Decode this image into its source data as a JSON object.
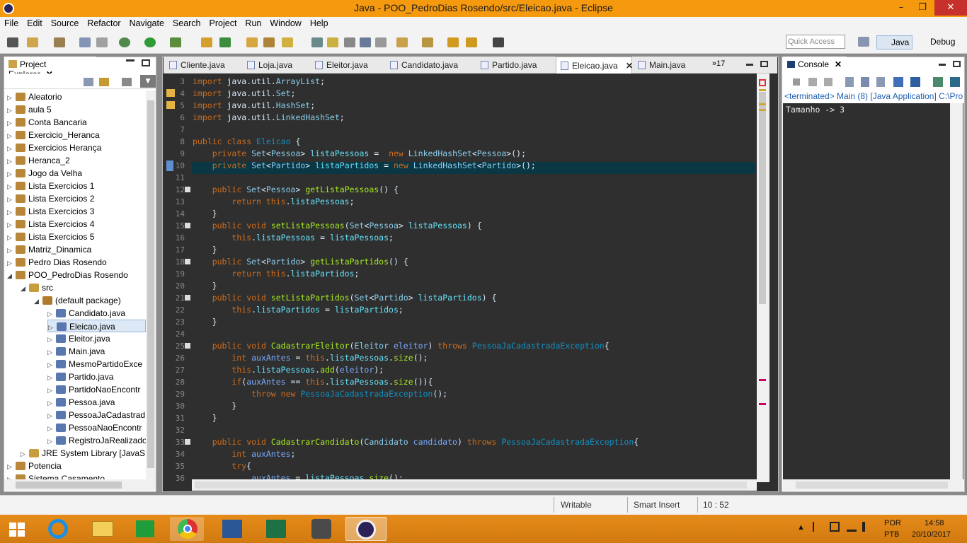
{
  "window": {
    "title": "Java - POO_PedroDias Rosendo/src/Eleicao.java - Eclipse",
    "min": "–",
    "max": "❐",
    "close": "✕"
  },
  "menu": [
    "File",
    "Edit",
    "Source",
    "Refactor",
    "Navigate",
    "Search",
    "Project",
    "Run",
    "Window",
    "Help"
  ],
  "quick_access": {
    "placeholder": "Quick Access"
  },
  "perspectives": {
    "java": "Java",
    "debug": "Debug"
  },
  "project_explorer": {
    "title": "Project Explorer",
    "items": [
      {
        "label": "Aleatorio",
        "depth": 0,
        "exp": "▷"
      },
      {
        "label": "aula 5",
        "depth": 0,
        "exp": "▷"
      },
      {
        "label": "Conta Bancaria",
        "depth": 0,
        "exp": "▷"
      },
      {
        "label": "Exercicio_Heranca",
        "depth": 0,
        "exp": "▷"
      },
      {
        "label": "Exercicios Herança",
        "depth": 0,
        "exp": "▷"
      },
      {
        "label": "Heranca_2",
        "depth": 0,
        "exp": "▷"
      },
      {
        "label": "Jogo da Velha",
        "depth": 0,
        "exp": "▷"
      },
      {
        "label": "Lista Exercicios 1",
        "depth": 0,
        "exp": "▷"
      },
      {
        "label": "Lista Exercicios 2",
        "depth": 0,
        "exp": "▷"
      },
      {
        "label": "Lista Exercicios 3",
        "depth": 0,
        "exp": "▷"
      },
      {
        "label": "Lista Exercicios 4",
        "depth": 0,
        "exp": "▷"
      },
      {
        "label": "Lista Exercicios 5",
        "depth": 0,
        "exp": "▷"
      },
      {
        "label": "Matriz_Dinamica",
        "depth": 0,
        "exp": "▷"
      },
      {
        "label": "Pedro Dias Rosendo",
        "depth": 0,
        "exp": "▷"
      },
      {
        "label": "POO_PedroDias Rosendo",
        "depth": 0,
        "exp": "◢"
      },
      {
        "label": "src",
        "depth": 1,
        "exp": "◢"
      },
      {
        "label": "(default package)",
        "depth": 2,
        "exp": "◢"
      },
      {
        "label": "Candidato.java",
        "depth": 3,
        "exp": "▷"
      },
      {
        "label": "Eleicao.java",
        "depth": 3,
        "exp": "▷",
        "selected": true
      },
      {
        "label": "Eleitor.java",
        "depth": 3,
        "exp": "▷"
      },
      {
        "label": "Main.java",
        "depth": 3,
        "exp": "▷"
      },
      {
        "label": "MesmoPartidoExce",
        "depth": 3,
        "exp": "▷"
      },
      {
        "label": "Partido.java",
        "depth": 3,
        "exp": "▷"
      },
      {
        "label": "PartidoNaoEncontr",
        "depth": 3,
        "exp": "▷"
      },
      {
        "label": "Pessoa.java",
        "depth": 3,
        "exp": "▷"
      },
      {
        "label": "PessoaJaCadastrad",
        "depth": 3,
        "exp": "▷"
      },
      {
        "label": "PessoaNaoEncontr",
        "depth": 3,
        "exp": "▷"
      },
      {
        "label": "RegistroJaRealizado",
        "depth": 3,
        "exp": "▷"
      },
      {
        "label": "JRE System Library [JavaSE",
        "depth": 1,
        "exp": "▷"
      },
      {
        "label": "Potencia",
        "depth": 0,
        "exp": "▷"
      },
      {
        "label": "Sistema Casamento",
        "depth": 0,
        "exp": "▷"
      }
    ]
  },
  "editor_tabs": [
    {
      "label": "Cliente.java"
    },
    {
      "label": "Loja.java"
    },
    {
      "label": "Eleitor.java"
    },
    {
      "label": "Candidato.java"
    },
    {
      "label": "Partido.java"
    },
    {
      "label": "Eleicao.java",
      "active": true
    },
    {
      "label": "Main.java"
    }
  ],
  "editor_overflow": "»17",
  "code_lines": [
    {
      "n": "3",
      "t": "import java.util.ArrayList;"
    },
    {
      "n": "4",
      "t": "import java.util.Set;"
    },
    {
      "n": "5",
      "t": "import java.util.HashSet;"
    },
    {
      "n": "6",
      "t": "import java.util.LinkedHashSet;"
    },
    {
      "n": "7",
      "t": ""
    },
    {
      "n": "8",
      "t": "public class Eleicao {"
    },
    {
      "n": "9",
      "t": "    private Set<Pessoa> listaPessoas =  new LinkedHashSet<Pessoa>();"
    },
    {
      "n": "10",
      "t": "    private Set<Partido> listaPartidos = new LinkedHashSet<Partido>();"
    },
    {
      "n": "11",
      "t": ""
    },
    {
      "n": "12",
      "t": "    public Set<Pessoa> getListaPessoas() {"
    },
    {
      "n": "13",
      "t": "        return this.listaPessoas;"
    },
    {
      "n": "14",
      "t": "    }"
    },
    {
      "n": "15",
      "t": "    public void setListaPessoas(Set<Pessoa> listaPessoas) {"
    },
    {
      "n": "16",
      "t": "        this.listaPessoas = listaPessoas;"
    },
    {
      "n": "17",
      "t": "    }"
    },
    {
      "n": "18",
      "t": "    public Set<Partido> getListaPartidos() {"
    },
    {
      "n": "19",
      "t": "        return this.listaPartidos;"
    },
    {
      "n": "20",
      "t": "    }"
    },
    {
      "n": "21",
      "t": "    public void setListaPartidos(Set<Partido> listaPartidos) {"
    },
    {
      "n": "22",
      "t": "        this.listaPartidos = listaPartidos;"
    },
    {
      "n": "23",
      "t": "    }"
    },
    {
      "n": "24",
      "t": ""
    },
    {
      "n": "25",
      "t": "    public void CadastrarEleitor(Eleitor eleitor) throws PessoaJaCadastradaException{"
    },
    {
      "n": "26",
      "t": "        int auxAntes = this.listaPessoas.size();"
    },
    {
      "n": "27",
      "t": "        this.listaPessoas.add(eleitor);"
    },
    {
      "n": "28",
      "t": "        if(auxAntes == this.listaPessoas.size()){"
    },
    {
      "n": "29",
      "t": "            throw new PessoaJaCadastradaException();"
    },
    {
      "n": "30",
      "t": "        }"
    },
    {
      "n": "31",
      "t": "    }"
    },
    {
      "n": "32",
      "t": ""
    },
    {
      "n": "33",
      "t": "    public void CadastrarCandidato(Candidato candidato) throws PessoaJaCadastradaException{"
    },
    {
      "n": "34",
      "t": "        int auxAntes;"
    },
    {
      "n": "35",
      "t": "        try{"
    },
    {
      "n": "36",
      "t": "            auxAntes = listaPessoas.size();"
    }
  ],
  "console": {
    "title": "Console",
    "header": "<terminated> Main (8) [Java Application] C:\\Pro",
    "output": "Tamanho -> 3"
  },
  "status": {
    "writable": "Writable",
    "insert": "Smart Insert",
    "position": "10 : 52"
  },
  "taskbar": {
    "lang1": "POR",
    "lang2": "PTB",
    "time": "14:58",
    "date": "20/10/2017"
  },
  "colors": {
    "titlebar": "#f59a0f",
    "editor_bg": "#2f2f2f",
    "taskbar": "#e0861a"
  }
}
